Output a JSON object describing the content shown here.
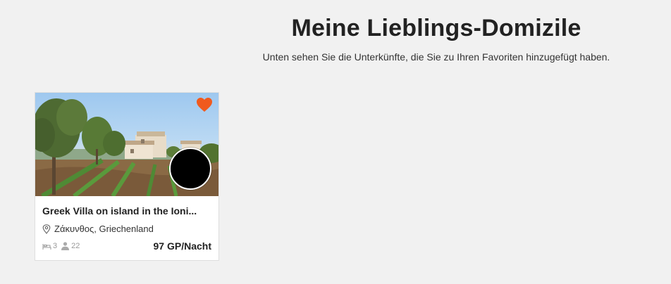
{
  "header": {
    "title": "Meine Lieblings-Domizile",
    "subtitle": "Unten sehen Sie die Unterkünfte, die Sie zu Ihren Favoriten hinzugefügt haben."
  },
  "favorites": [
    {
      "title": "Greek Villa on island in the Ioni...",
      "location": "Ζάκυνθος, Griechenland",
      "bedrooms": "3",
      "guests": "22",
      "price": "97 GP/Nacht",
      "favorite_icon": "heart-icon",
      "favorite_color": "#f05a1e"
    }
  ],
  "icons": {
    "location": "map-pin-icon",
    "bedrooms": "bed-icon",
    "guests": "person-icon"
  }
}
